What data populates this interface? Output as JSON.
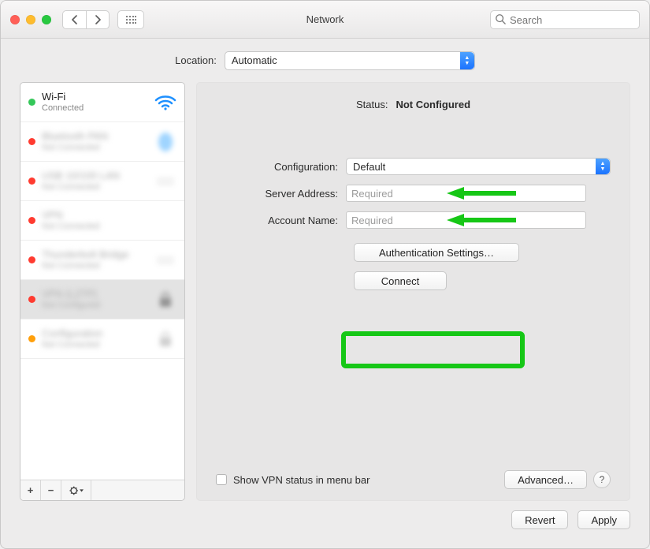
{
  "window": {
    "title": "Network",
    "search_placeholder": "Search"
  },
  "location": {
    "label": "Location:",
    "selected": "Automatic"
  },
  "sidebar": {
    "items": [
      {
        "title": "Wi-Fi",
        "subtitle": "Connected",
        "status": "green"
      }
    ],
    "footer": {
      "add": "+",
      "remove": "−",
      "gear": "✽▾"
    }
  },
  "detail": {
    "status_label": "Status:",
    "status_value": "Not Configured",
    "config_label": "Configuration:",
    "config_value": "Default",
    "server_label": "Server Address:",
    "server_placeholder": "Required",
    "account_label": "Account Name:",
    "account_placeholder": "Required",
    "auth_button": "Authentication Settings…",
    "connect_button": "Connect",
    "show_vpn_label": "Show VPN status in menu bar",
    "advanced_button": "Advanced…",
    "help": "?"
  },
  "footer": {
    "revert": "Revert",
    "apply": "Apply"
  }
}
